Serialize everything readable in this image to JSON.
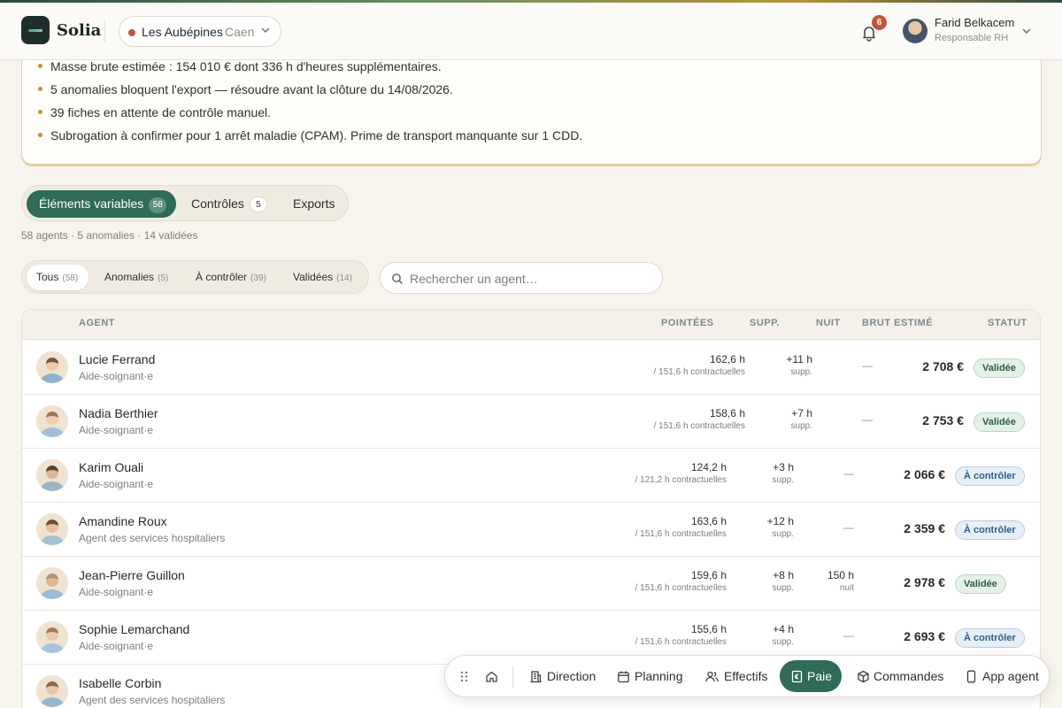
{
  "header": {
    "brand": "Solia",
    "site": {
      "name": "Les Aubépines",
      "city": "Caen",
      "status_color": "#c0563d"
    },
    "notifications_count": "6",
    "user": {
      "name": "Farid Belkacem",
      "role": "Responsable RH"
    }
  },
  "summary": {
    "items": [
      "Masse brute estimée : 154 010 € dont 336 h d'heures supplémentaires.",
      "5 anomalies bloquent l'export — résoudre avant la clôture du 14/08/2026.",
      "39 fiches en attente de contrôle manuel.",
      "Subrogation à confirmer pour 1 arrêt maladie (CPAM). Prime de transport manquante sur 1 CDD."
    ]
  },
  "main_tabs": [
    {
      "label": "Éléments variables",
      "count": "58",
      "active": true
    },
    {
      "label": "Contrôles",
      "count": "5",
      "active": false
    },
    {
      "label": "Exports",
      "count": "",
      "active": false
    }
  ],
  "stats_line": "58 agents · 5 anomalies · 14 validées",
  "filters": [
    {
      "label": "Tous",
      "count": "(58)",
      "active": true
    },
    {
      "label": "Anomalies",
      "count": "(5)",
      "active": false
    },
    {
      "label": "À contrôler",
      "count": "(39)",
      "active": false
    },
    {
      "label": "Validées",
      "count": "(14)",
      "active": false
    }
  ],
  "search": {
    "placeholder": "Rechercher un agent…",
    "value": ""
  },
  "table": {
    "columns": {
      "agent": "AGENT",
      "pointees": "POINTÉES",
      "supp": "SUPP.",
      "nuit": "NUIT",
      "brut": "BRUT ESTIMÉ",
      "statut": "STATUT"
    },
    "rows": [
      {
        "name": "Lucie Ferrand",
        "role": "Aide-soignant·e",
        "hours": "162,6 h",
        "contract": "/ 151,6 h contractuelles",
        "supp": "+11 h",
        "supp_unit": "supp.",
        "night": "",
        "night_unit": "",
        "dash": "—",
        "brut": "2 708 €",
        "status": "Validée",
        "status_kind": "ok"
      },
      {
        "name": "Nadia Berthier",
        "role": "Aide-soignant·e",
        "hours": "158,6 h",
        "contract": "/ 151,6 h contractuelles",
        "supp": "+7 h",
        "supp_unit": "supp.",
        "night": "",
        "night_unit": "",
        "dash": "—",
        "brut": "2 753 €",
        "status": "Validée",
        "status_kind": "ok"
      },
      {
        "name": "Karim Ouali",
        "role": "Aide-soignant·e",
        "hours": "124,2 h",
        "contract": "/ 121,2 h contractuelles",
        "supp": "+3 h",
        "supp_unit": "supp.",
        "night": "",
        "night_unit": "",
        "dash": "—",
        "brut": "2 066 €",
        "status": "À contrôler",
        "status_kind": "check"
      },
      {
        "name": "Amandine Roux",
        "role": "Agent des services hospitaliers",
        "hours": "163,6 h",
        "contract": "/ 151,6 h contractuelles",
        "supp": "+12 h",
        "supp_unit": "supp.",
        "night": "",
        "night_unit": "",
        "dash": "—",
        "brut": "2 359 €",
        "status": "À contrôler",
        "status_kind": "check"
      },
      {
        "name": "Jean-Pierre Guillon",
        "role": "Aide-soignant·e",
        "hours": "159,6 h",
        "contract": "/ 151,6 h contractuelles",
        "supp": "+8 h",
        "supp_unit": "supp.",
        "night": "150 h",
        "night_unit": "nuit",
        "dash": "",
        "brut": "2 978 €",
        "status": "Validée",
        "status_kind": "ok"
      },
      {
        "name": "Sophie Lemarchand",
        "role": "Aide-soignant·e",
        "hours": "155,6 h",
        "contract": "/ 151,6 h contractuelles",
        "supp": "+4 h",
        "supp_unit": "supp.",
        "night": "",
        "night_unit": "",
        "dash": "—",
        "brut": "2 693 €",
        "status": "À contrôler",
        "status_kind": "check"
      },
      {
        "name": "Isabelle Corbin",
        "role": "Agent des services hospitaliers",
        "hours": "",
        "contract": "",
        "supp": "",
        "supp_unit": "",
        "night": "",
        "night_unit": "",
        "dash": "",
        "brut": "",
        "status": "",
        "status_kind": ""
      }
    ]
  },
  "dock": [
    {
      "label": "",
      "icon": "home-icon",
      "active": false
    },
    {
      "label": "Direction",
      "icon": "building-icon",
      "active": false
    },
    {
      "label": "Planning",
      "icon": "calendar-icon",
      "active": false
    },
    {
      "label": "Effectifs",
      "icon": "users-icon",
      "active": false
    },
    {
      "label": "Paie",
      "icon": "payslip-icon",
      "active": true
    },
    {
      "label": "Commandes",
      "icon": "box-icon",
      "active": false
    },
    {
      "label": "App agent",
      "icon": "phone-icon",
      "active": false
    }
  ],
  "colors": {
    "accent": "#2f6b57",
    "warning_bullet": "#c98f3a",
    "ok": "#2f5e45",
    "check": "#2f5d87"
  }
}
